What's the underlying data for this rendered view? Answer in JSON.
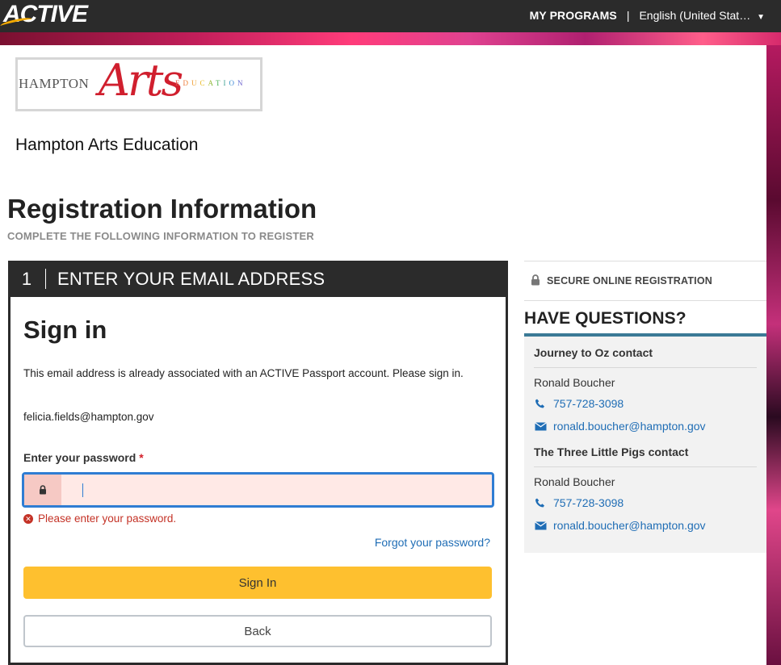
{
  "topbar": {
    "brand": "ACTIVE",
    "my_programs": "MY PROGRAMS",
    "separator": "|",
    "language": "English (United Stat…"
  },
  "org": {
    "logo_text_hampton": "HAMPTON",
    "logo_text_arts": "Arts",
    "logo_text_education": "EDUCATION",
    "name": "Hampton Arts Education"
  },
  "page": {
    "title": "Registration Information",
    "subtitle": "COMPLETE THE FOLLOWING INFORMATION TO REGISTER"
  },
  "step": {
    "number": "1",
    "title": "ENTER YOUR EMAIL ADDRESS"
  },
  "signin": {
    "title": "Sign in",
    "message": "This email address is already associated with an ACTIVE Passport account. Please sign in.",
    "email": "felicia.fields@hampton.gov",
    "password_label": "Enter your password",
    "required_mark": "*",
    "password_value": "",
    "error": "Please enter your password.",
    "forgot": "Forgot your password?",
    "signin_button": "Sign In",
    "back_button": "Back"
  },
  "sidebar": {
    "secure": "SECURE ONLINE REGISTRATION",
    "questions_title": "HAVE QUESTIONS?",
    "contacts": [
      {
        "title": "Journey to Oz contact",
        "name": "Ronald Boucher",
        "phone": "757-728-3098",
        "email": "ronald.boucher@hampton.gov"
      },
      {
        "title": "The Three Little Pigs contact",
        "name": "Ronald Boucher",
        "phone": "757-728-3098",
        "email": "ronald.boucher@hampton.gov"
      }
    ]
  },
  "colors": {
    "accent_yellow": "#fec02f",
    "link_blue": "#1f6db5",
    "error_red": "#c43226",
    "dark": "#2b2b2b"
  }
}
